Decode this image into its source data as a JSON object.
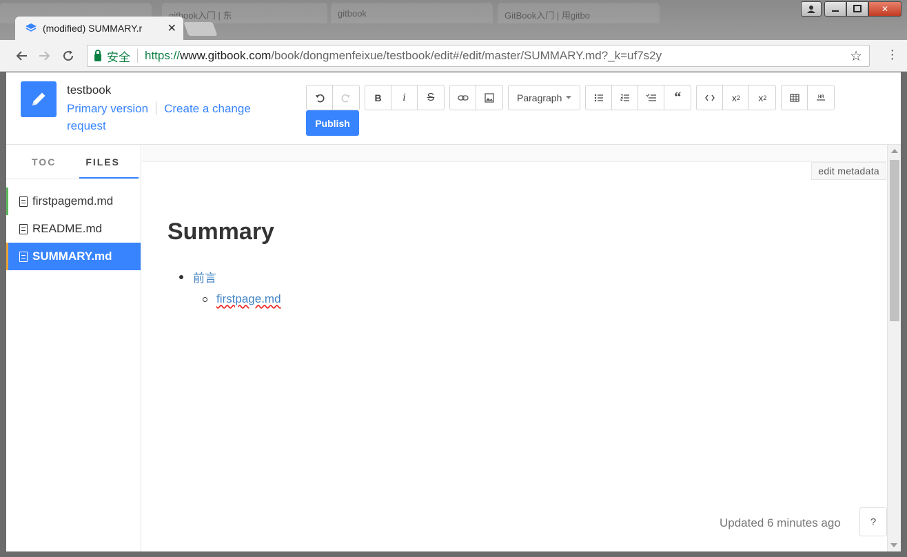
{
  "browser": {
    "active_tab_title": "(modified) SUMMARY.r",
    "bg_tabs": [
      "gitbook",
      "gitbook入门 | 东",
      "GitBook入门 | 用gitbo"
    ],
    "url": {
      "secure_label": "安全",
      "scheme": "https://",
      "host": "www.gitbook.com",
      "path": "/book/dongmenfeixue/testbook/edit#/edit/master/SUMMARY.md?_k=uf7s2y"
    }
  },
  "header": {
    "book_name": "testbook",
    "primary_version": "Primary version",
    "change_request": "Create a change request",
    "paragraph_label": "Paragraph",
    "publish_label": "Publish"
  },
  "sidebar": {
    "tabs": [
      "TOC",
      "FILES"
    ],
    "files": [
      {
        "name": "firstpagemd.md"
      },
      {
        "name": "README.md"
      },
      {
        "name": "SUMMARY.md"
      }
    ]
  },
  "content": {
    "edit_metadata": "edit metadata",
    "title": "Summary",
    "item1": "前言",
    "item2": "firstpage.md",
    "updated": "Updated 6 minutes ago",
    "help": "?"
  },
  "colors": {
    "accent": "#3884ff",
    "link": "#4183c4",
    "selected_marker": "#e8a33c",
    "modified_marker": "#5cb85c"
  }
}
